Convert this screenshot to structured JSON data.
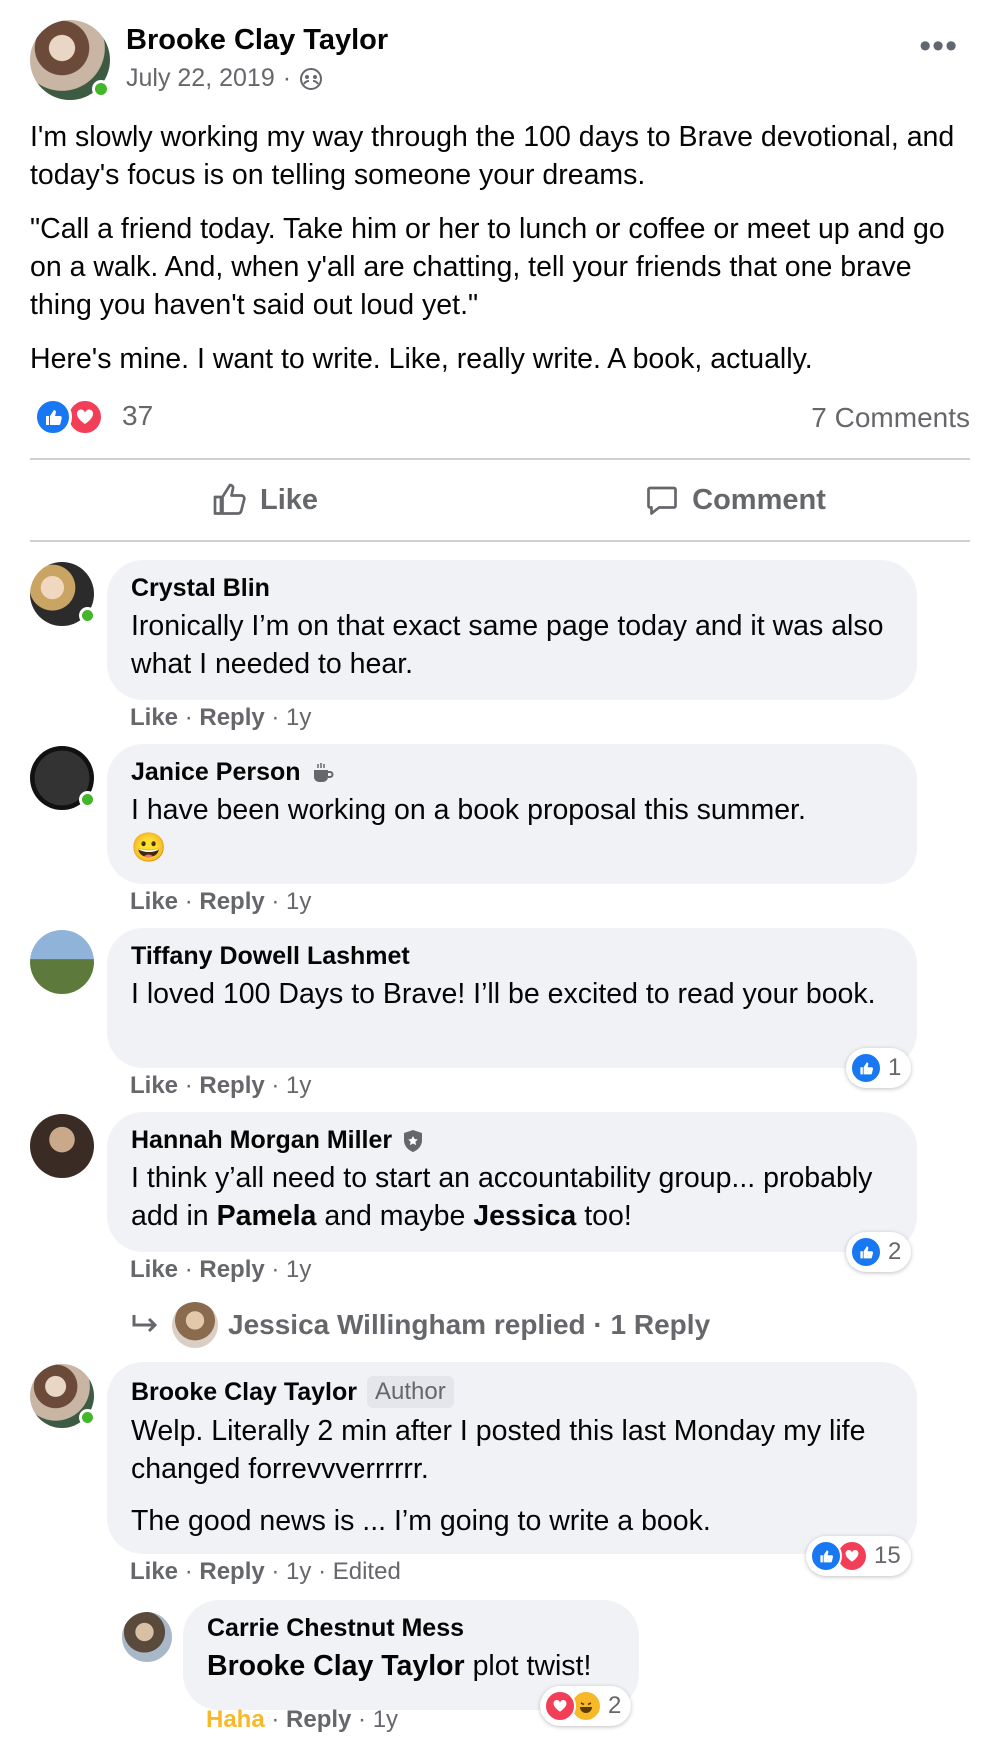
{
  "post": {
    "author": "Brooke Clay Taylor",
    "date": "July 22, 2019",
    "separator": "·",
    "more_label": "•••",
    "paragraphs": [
      "I'm slowly working my way through the 100 days to Brave devotional, and today's focus is on telling someone your dreams.",
      "\"Call a friend today. Take him or her to lunch or coffee or meet up and go on a walk. And, when y'all are chatting, tell your friends that one brave thing you haven't said out  loud yet.\"",
      "Here's mine. I want to write. Like, really write. A book, actually."
    ],
    "reaction_count": "37",
    "comments_count": "7 Comments",
    "like_label": "Like",
    "comment_label": "Comment"
  },
  "comments": [
    {
      "name": "Crystal Blin",
      "text": "Ironically I’m on that exact same page today and it was also what I needed to hear.",
      "like": "Like",
      "reply": "Reply",
      "time": "1y"
    },
    {
      "name": "Janice Person",
      "text": "I have been working on a book proposal this summer.",
      "emoji": "😀",
      "like": "Like",
      "reply": "Reply",
      "time": "1y"
    },
    {
      "name": "Tiffany Dowell Lashmet",
      "text": "I loved 100 Days to Brave! I’ll be excited to read your book.",
      "like": "Like",
      "reply": "Reply",
      "time": "1y",
      "reactions": "1"
    },
    {
      "name": "Hannah Morgan Miller",
      "text_1": "I think y’all need to start an accountability group... probably add in ",
      "mention_1": "Pamela",
      "text_2": " and maybe ",
      "mention_2": "Jessica",
      "text_3": " too!",
      "like": "Like",
      "reply": "Reply",
      "time": "1y",
      "reactions": "2",
      "replies_summary": "Jessica Willingham replied · 1 Reply"
    },
    {
      "name": "Brooke Clay Taylor",
      "badge": "Author",
      "text": "Welp. Literally 2 min after I posted this last Monday my life changed forrevvverrrrrr.",
      "text_2": "The good news is ... I’m going to write a book.",
      "like": "Like",
      "reply": "Reply",
      "time": "1y",
      "edited": "Edited",
      "reactions": "15"
    },
    {
      "name": "Carrie Chestnut Mess",
      "mention": "Brooke Clay Taylor",
      "text": " plot twist!",
      "like": "Haha",
      "reply": "Reply",
      "time": "1y",
      "reactions": "2"
    }
  ],
  "colors": {
    "like_blue": "#1877f2",
    "love_red": "#f33e58",
    "haha_yellow": "#f7b928",
    "bubble": "#f0f2f5",
    "online": "#42b72a"
  }
}
